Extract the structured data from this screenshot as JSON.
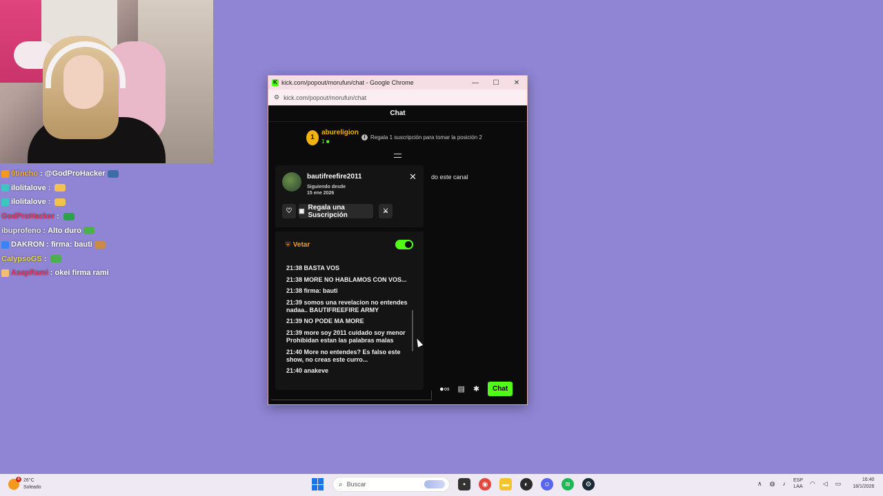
{
  "overlay_chat": [
    {
      "user": "6tincho",
      "user_color": "#f0b429",
      "badge_color": "#f39a1e",
      "message": "@GodProHacker",
      "emote_color": "#3a6ea5"
    },
    {
      "user": "ilolitalove",
      "user_color": "#ffffff",
      "badge_color": "#40c4c0",
      "message": "",
      "emote_color": "#f2c14e"
    },
    {
      "user": "ilolitalove",
      "user_color": "#ffffff",
      "badge_color": "#40c4c0",
      "message": "",
      "emote_color": "#f2c14e"
    },
    {
      "user": "GodProHacker",
      "user_color": "#e8365d",
      "badge_color": "",
      "message": "",
      "emote_color": "#2aa34a"
    },
    {
      "user": "ibuprofeno",
      "user_color": "#e6e6e6",
      "badge_color": "",
      "message": "Alto duro",
      "emote_color": "#4caf50"
    },
    {
      "user": "DAKRON",
      "user_color": "#ffffff",
      "badge_color": "#3b82f6",
      "message": "firma: bauti",
      "emote_color": "#c98a4b"
    },
    {
      "user": "CalypsoGS",
      "user_color": "#e6d84a",
      "badge_color": "",
      "message": "",
      "emote_color": "#4caf50"
    },
    {
      "user": "AsapRami",
      "user_color": "#e8365d",
      "badge_color": "#f0c070",
      "message": "okei firma rami",
      "emote_color": ""
    }
  ],
  "window": {
    "title": "kick.com/popout/morufun/chat - Google Chrome",
    "url": "kick.com/popout/morufun/chat",
    "favicon": "K",
    "header": "Chat"
  },
  "leaderboard": {
    "position": "1",
    "name": "abureligion",
    "count": "1",
    "info": "Regala 1 suscripción para tomar la posición 2"
  },
  "background_message": "do este canal",
  "user_card": {
    "username": "bautifreefire2011",
    "following_label": "Siguiendo desde",
    "following_date": "15 ene 2026",
    "gift_label": "Regala una Suscripción",
    "ban_label": "Vetar",
    "ban_enabled": true,
    "messages": [
      "21:38 BASTA VOS",
      "21:38 MORE NO HABLAMOS CON VOS...",
      "21:38 firma: bauti",
      "21:39 somos una revelacion no entendes nadaa.. BAUTIFREEFIRE ARMY",
      "21:39 NO PODE MA MORE",
      "21:39 more soy 2011 cuidado soy menor Prohibidan estan las palabras malas",
      "21:40 More no entendes? Es falso este show, no creas este curro...",
      "21:40 anakeve"
    ]
  },
  "toolbar": {
    "chat_button": "Chat"
  },
  "taskbar": {
    "weather_temp": "26°C",
    "weather_desc": "Soleado",
    "weather_badge": "4",
    "search_placeholder": "Buscar",
    "lang_top": "ESP",
    "lang_bottom": "LAA",
    "time": "16:40",
    "date": "18/1/2026"
  },
  "colors": {
    "desktop_bg": "#8f85d4",
    "kick_green": "#53fc18",
    "gold": "#f2b211",
    "ban_orange": "#f0a030"
  }
}
